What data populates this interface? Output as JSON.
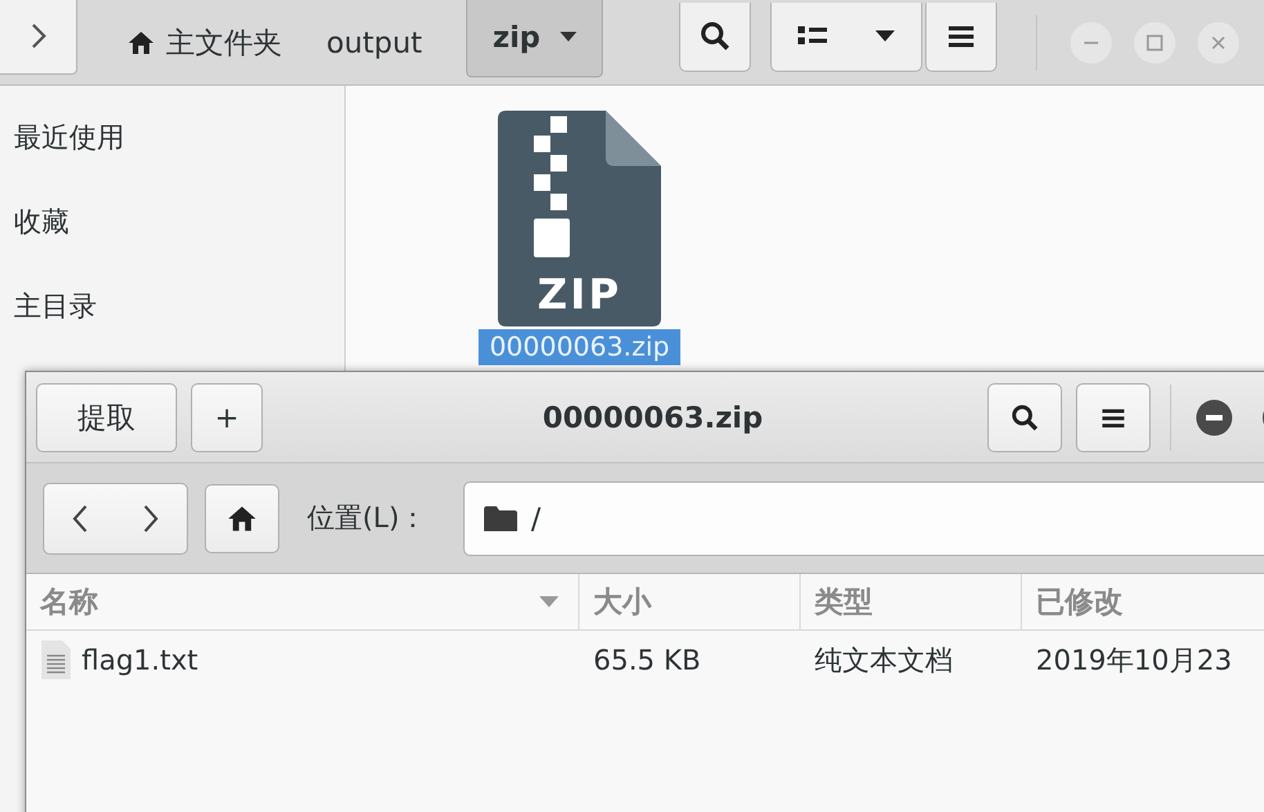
{
  "back_window": {
    "path": [
      {
        "label": "主文件夹",
        "kind": "home",
        "selected": false
      },
      {
        "label": "output",
        "kind": "plain",
        "selected": false
      },
      {
        "label": "zip",
        "kind": "plain",
        "selected": true
      }
    ],
    "sidebar": {
      "items": [
        {
          "label": "最近使用"
        },
        {
          "label": "收藏"
        },
        {
          "label": "主目录"
        }
      ]
    },
    "files": [
      {
        "name": "00000063.zip",
        "badge": "ZIP",
        "selected": true
      }
    ]
  },
  "archive_window": {
    "title": "00000063.zip",
    "buttons": [
      "提取",
      "+"
    ],
    "location": {
      "label": "位置(L)：",
      "value": "/"
    },
    "columns": [
      {
        "label": "名称",
        "sorted": true
      },
      {
        "label": "大小",
        "sorted": false
      },
      {
        "label": "类型",
        "sorted": false
      },
      {
        "label": "已修改",
        "sorted": false
      }
    ],
    "rows": [
      {
        "name": "flag1.txt",
        "size": "65.5 KB",
        "type": "纯文本文档",
        "modified": "2019年10月23"
      }
    ]
  }
}
